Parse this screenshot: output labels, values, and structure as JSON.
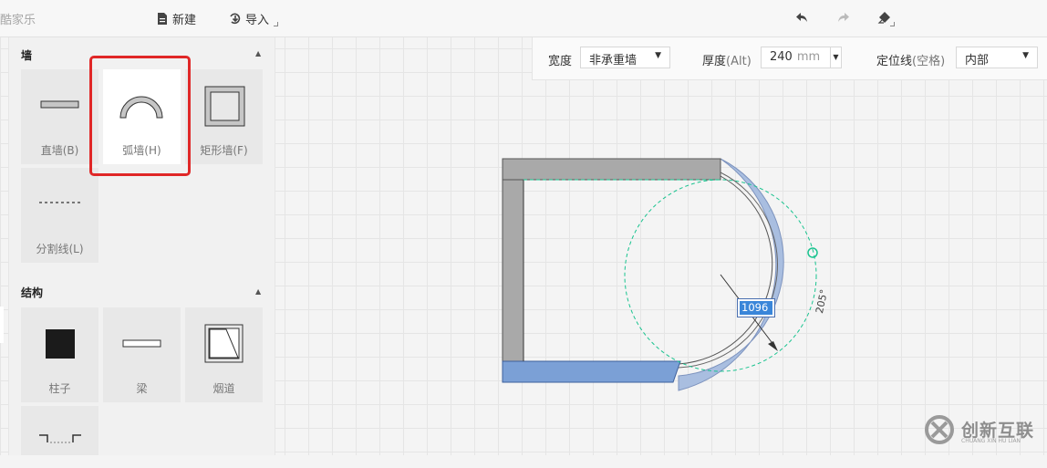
{
  "app": {
    "name": "酷家乐"
  },
  "toolbar": {
    "new_label": "新建",
    "import_label": "导入",
    "icons": [
      "file-icon",
      "import-icon",
      "undo-icon",
      "redo-icon",
      "eraser-icon"
    ]
  },
  "props": {
    "width_label": "宽度",
    "width_value": "非承重墙",
    "thickness_label": "厚度",
    "thickness_hint": "(Alt)",
    "thickness_value": "240",
    "thickness_unit": "mm",
    "locate_label": "定位线",
    "locate_hint": "(空格)",
    "locate_value": "内部"
  },
  "sidebar": {
    "wall_section": {
      "title": "墙",
      "items": [
        {
          "label": "直墙(B)",
          "icon": "straight-wall-icon"
        },
        {
          "label": "弧墙(H)",
          "icon": "arc-wall-icon",
          "active": true
        },
        {
          "label": "矩形墙(F)",
          "icon": "rect-wall-icon"
        },
        {
          "label": "分割线(L)",
          "icon": "divider-line-icon"
        }
      ]
    },
    "structure_section": {
      "title": "结构",
      "items": [
        {
          "label": "柱子",
          "icon": "column-icon"
        },
        {
          "label": "梁",
          "icon": "beam-icon"
        },
        {
          "label": "烟道",
          "icon": "flue-icon"
        }
      ]
    }
  },
  "canvas": {
    "radius_value": "1096",
    "angle_value": "205°",
    "colors": {
      "wall_gray": "#a9a9a9",
      "wall_blue": "#7ba0d6",
      "arc_fill": "#a9bee0",
      "guide_green": "#19c38f"
    }
  },
  "watermark": {
    "text": "创新互联",
    "sub": "CHUANG XIN HU LIAN"
  }
}
